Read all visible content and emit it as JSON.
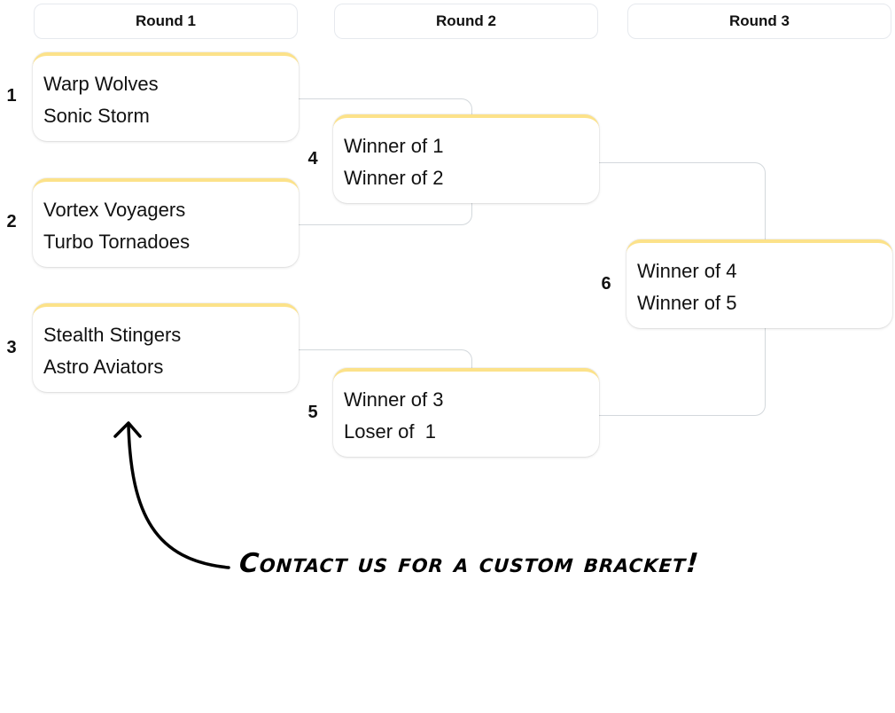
{
  "rounds": [
    {
      "label": "Round 1"
    },
    {
      "label": "Round 2"
    },
    {
      "label": "Round 3"
    }
  ],
  "matches": [
    {
      "number": "1",
      "teams": [
        "Warp Wolves",
        "Sonic Storm"
      ]
    },
    {
      "number": "2",
      "teams": [
        "Vortex Voyagers",
        "Turbo Tornadoes"
      ]
    },
    {
      "number": "3",
      "teams": [
        "Stealth Stingers",
        "Astro Aviators"
      ]
    },
    {
      "number": "4",
      "teams": [
        "Winner of 1",
        "Winner of 2"
      ]
    },
    {
      "number": "5",
      "teams": [
        "Winner of 3",
        "Loser of  1"
      ]
    },
    {
      "number": "6",
      "teams": [
        "Winner of 4",
        "Winner of 5"
      ]
    }
  ],
  "colors": {
    "accent": "#fce28a",
    "connector": "#d3d8dc",
    "header_border": "#e6e9ee"
  },
  "cta": {
    "text": "Contact us for a custom bracket!",
    "icon": "curved-arrow-up-icon"
  }
}
